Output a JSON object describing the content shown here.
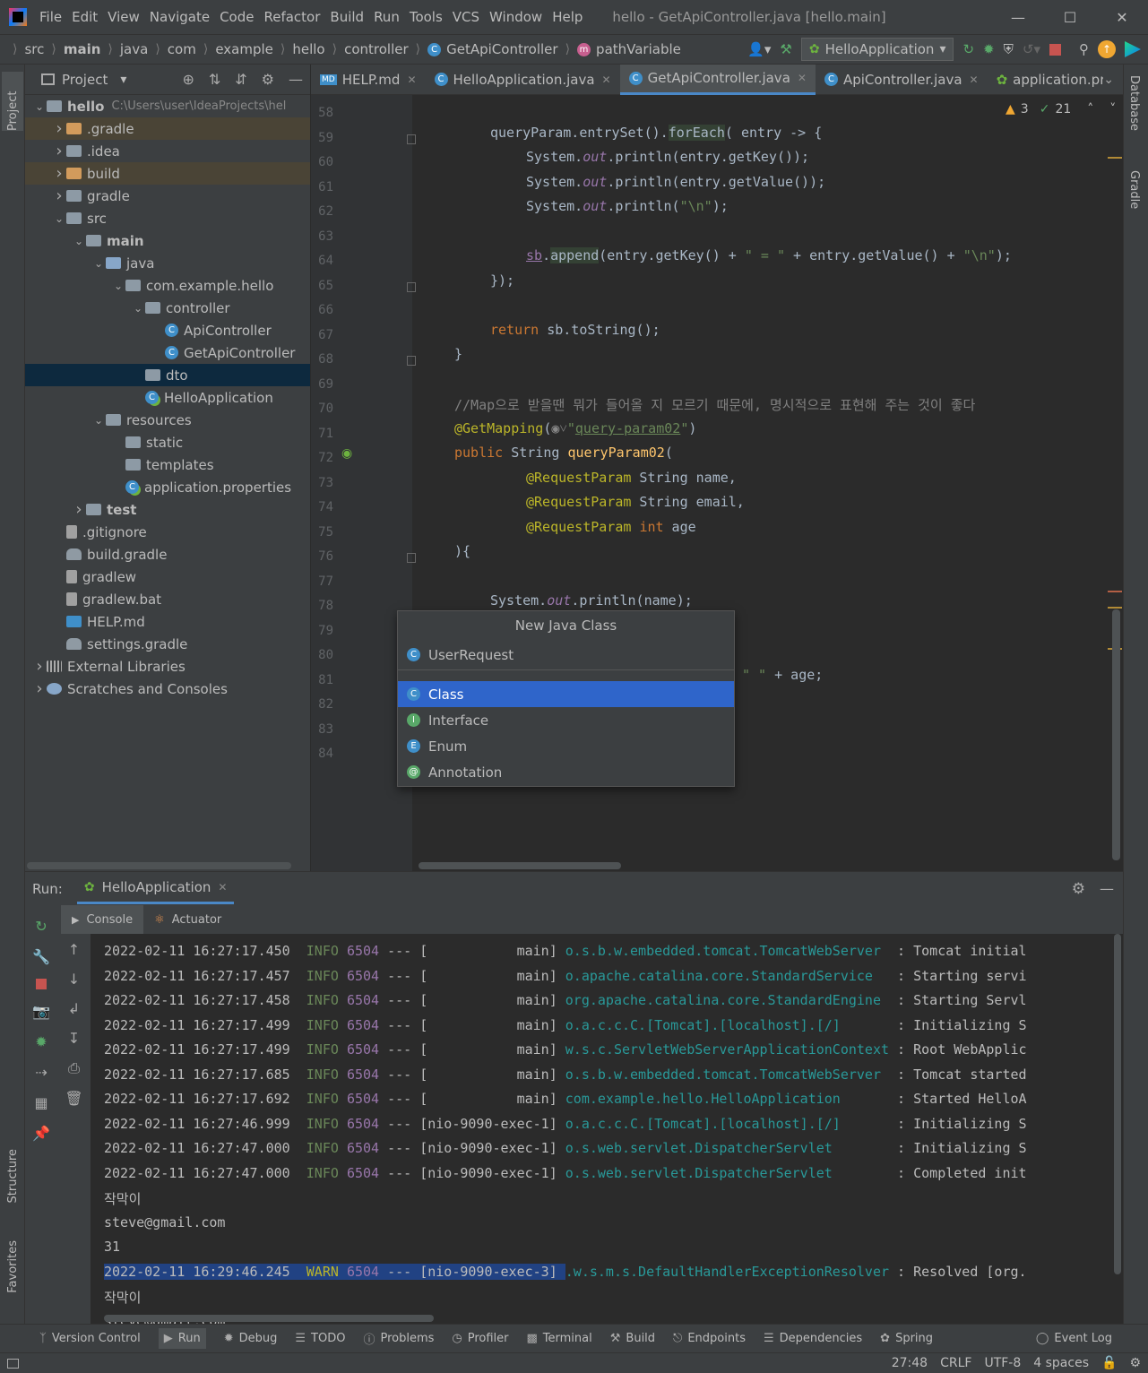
{
  "menu": [
    "File",
    "Edit",
    "View",
    "Navigate",
    "Code",
    "Refactor",
    "Build",
    "Run",
    "Tools",
    "VCS",
    "Window",
    "Help"
  ],
  "window_title": "hello - GetApiController.java [hello.main]",
  "breadcrumbs": [
    "src",
    "main",
    "java",
    "com",
    "example",
    "hello",
    "controller",
    "GetApiController",
    "pathVariable"
  ],
  "run_config": "HelloApplication",
  "project_header": "Project",
  "tree": [
    {
      "label": "hello",
      "hint": "C:\\Users\\user\\IdeaProjects\\hel",
      "indent": 0,
      "arrow": "v",
      "icon": "folder",
      "bold": true
    },
    {
      "label": ".gradle",
      "indent": 1,
      "arrow": ">",
      "icon": "folder-orange",
      "excluded": true
    },
    {
      "label": ".idea",
      "indent": 1,
      "arrow": ">",
      "icon": "folder"
    },
    {
      "label": "build",
      "indent": 1,
      "arrow": ">",
      "icon": "folder-orange",
      "excluded": true
    },
    {
      "label": "gradle",
      "indent": 1,
      "arrow": ">",
      "icon": "folder"
    },
    {
      "label": "src",
      "indent": 1,
      "arrow": "v",
      "icon": "folder"
    },
    {
      "label": "main",
      "indent": 2,
      "arrow": "v",
      "icon": "folder",
      "bold": true
    },
    {
      "label": "java",
      "indent": 3,
      "arrow": "v",
      "icon": "folder-blue"
    },
    {
      "label": "com.example.hello",
      "indent": 4,
      "arrow": "v",
      "icon": "folder"
    },
    {
      "label": "controller",
      "indent": 5,
      "arrow": "v",
      "icon": "folder"
    },
    {
      "label": "ApiController",
      "indent": 6,
      "arrow": "",
      "icon": "class"
    },
    {
      "label": "GetApiController",
      "indent": 6,
      "arrow": "",
      "icon": "class"
    },
    {
      "label": "dto",
      "indent": 5,
      "arrow": "",
      "icon": "folder",
      "selected": true
    },
    {
      "label": "HelloApplication",
      "indent": 5,
      "arrow": "",
      "icon": "spring"
    },
    {
      "label": "resources",
      "indent": 3,
      "arrow": "v",
      "icon": "folder"
    },
    {
      "label": "static",
      "indent": 4,
      "arrow": "",
      "icon": "folder"
    },
    {
      "label": "templates",
      "indent": 4,
      "arrow": "",
      "icon": "folder"
    },
    {
      "label": "application.properties",
      "indent": 4,
      "arrow": "",
      "icon": "spring"
    },
    {
      "label": "test",
      "indent": 2,
      "arrow": ">",
      "icon": "folder",
      "bold": true
    },
    {
      "label": ".gitignore",
      "indent": 1,
      "arrow": "",
      "icon": "file"
    },
    {
      "label": "build.gradle",
      "indent": 1,
      "arrow": "",
      "icon": "gradle"
    },
    {
      "label": "gradlew",
      "indent": 1,
      "arrow": "",
      "icon": "file"
    },
    {
      "label": "gradlew.bat",
      "indent": 1,
      "arrow": "",
      "icon": "file"
    },
    {
      "label": "HELP.md",
      "indent": 1,
      "arrow": "",
      "icon": "md"
    },
    {
      "label": "settings.gradle",
      "indent": 1,
      "arrow": "",
      "icon": "gradle"
    },
    {
      "label": "External Libraries",
      "indent": 0,
      "arrow": ">",
      "icon": "lib"
    },
    {
      "label": "Scratches and Consoles",
      "indent": 0,
      "arrow": ">",
      "icon": "scratch"
    }
  ],
  "tabs": [
    {
      "label": "HELP.md",
      "active": false
    },
    {
      "label": "HelloApplication.java",
      "active": false
    },
    {
      "label": "GetApiController.java",
      "active": true
    },
    {
      "label": "ApiController.java",
      "active": false
    },
    {
      "label": "application.prop",
      "active": false
    }
  ],
  "inspections": {
    "warnings": "3",
    "ok": "21"
  },
  "line_numbers": [
    "58",
    "59",
    "60",
    "61",
    "62",
    "63",
    "64",
    "65",
    "66",
    "67",
    "68",
    "69",
    "70",
    "71",
    "72",
    "73",
    "74",
    "75",
    "76",
    "77",
    "78",
    "79",
    "80",
    "81",
    "82",
    "83",
    "84"
  ],
  "popup": {
    "title": "New Java Class",
    "input": "UserRequest",
    "options": [
      "Class",
      "Interface",
      "Enum",
      "Annotation"
    ],
    "selected": "Class"
  },
  "code_fragment_81": "\" \" + age;",
  "run": {
    "label": "Run:",
    "config": "HelloApplication",
    "tabs": [
      "Console",
      "Actuator"
    ]
  },
  "log": [
    {
      "ts": "2022-02-11 16:27:17.450",
      "lvl": "INFO",
      "pid": "6504",
      "sep": "---",
      "thread": "[           main]",
      "logger": "o.s.b.w.embedded.tomcat.TomcatWebServer  ",
      "msg": ": Tomcat initial"
    },
    {
      "ts": "2022-02-11 16:27:17.457",
      "lvl": "INFO",
      "pid": "6504",
      "sep": "---",
      "thread": "[           main]",
      "logger": "o.apache.catalina.core.StandardService   ",
      "msg": ": Starting servi"
    },
    {
      "ts": "2022-02-11 16:27:17.458",
      "lvl": "INFO",
      "pid": "6504",
      "sep": "---",
      "thread": "[           main]",
      "logger": "org.apache.catalina.core.StandardEngine  ",
      "msg": ": Starting Servl"
    },
    {
      "ts": "2022-02-11 16:27:17.499",
      "lvl": "INFO",
      "pid": "6504",
      "sep": "---",
      "thread": "[           main]",
      "logger": "o.a.c.c.C.[Tomcat].[localhost].[/]       ",
      "msg": ": Initializing S"
    },
    {
      "ts": "2022-02-11 16:27:17.499",
      "lvl": "INFO",
      "pid": "6504",
      "sep": "---",
      "thread": "[           main]",
      "logger": "w.s.c.ServletWebServerApplicationContext ",
      "msg": ": Root WebApplic"
    },
    {
      "ts": "2022-02-11 16:27:17.685",
      "lvl": "INFO",
      "pid": "6504",
      "sep": "---",
      "thread": "[           main]",
      "logger": "o.s.b.w.embedded.tomcat.TomcatWebServer  ",
      "msg": ": Tomcat started"
    },
    {
      "ts": "2022-02-11 16:27:17.692",
      "lvl": "INFO",
      "pid": "6504",
      "sep": "---",
      "thread": "[           main]",
      "logger": "com.example.hello.HelloApplication       ",
      "msg": ": Started HelloA"
    },
    {
      "ts": "2022-02-11 16:27:46.999",
      "lvl": "INFO",
      "pid": "6504",
      "sep": "---",
      "thread": "[nio-9090-exec-1]",
      "logger": "o.a.c.c.C.[Tomcat].[localhost].[/]       ",
      "msg": ": Initializing S"
    },
    {
      "ts": "2022-02-11 16:27:47.000",
      "lvl": "INFO",
      "pid": "6504",
      "sep": "---",
      "thread": "[nio-9090-exec-1]",
      "logger": "o.s.web.servlet.DispatcherServlet        ",
      "msg": ": Initializing S"
    },
    {
      "ts": "2022-02-11 16:27:47.000",
      "lvl": "INFO",
      "pid": "6504",
      "sep": "---",
      "thread": "[nio-9090-exec-1]",
      "logger": "o.s.web.servlet.DispatcherServlet        ",
      "msg": ": Completed init"
    }
  ],
  "output_lines": [
    "작막이",
    "steve@gmail.com",
    "31"
  ],
  "warn_line": {
    "ts": "2022-02-11 16:29:46.245",
    "lvl": "WARN",
    "pid": "6504",
    "sep": "---",
    "thread": "[nio-9090-exec-3]",
    "logger": ".w.s.m.s.DefaultHandlerExceptionResolver ",
    "msg": ": Resolved [org."
  },
  "output_after": [
    "작막이",
    "steve@gmail.com"
  ],
  "bottom_tools": [
    "Version Control",
    "Run",
    "Debug",
    "TODO",
    "Problems",
    "Profiler",
    "Terminal",
    "Build",
    "Endpoints",
    "Dependencies",
    "Spring",
    "Event Log"
  ],
  "status": {
    "position": "27:48",
    "line_sep": "CRLF",
    "encoding": "UTF-8",
    "indent": "4 spaces"
  },
  "side_left": [
    "Project",
    "Structure",
    "Favorites"
  ],
  "side_right": [
    "Database",
    "Gradle"
  ]
}
